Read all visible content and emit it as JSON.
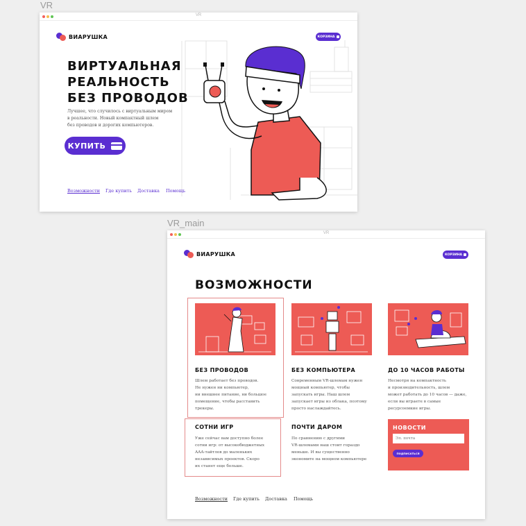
{
  "frames": {
    "vr": {
      "label": "VR",
      "title": "VR"
    },
    "vr_main": {
      "label": "VR_main",
      "title": "VR"
    }
  },
  "window_controls": {
    "close": "#f2605b",
    "minimize": "#f5be4f",
    "maximize": "#61c554"
  },
  "brand": {
    "name": "ВИАРУШКА",
    "accent": "#5a2ed1",
    "coral": "#ed5b55"
  },
  "cart": {
    "label": "КОРЗИНА"
  },
  "hero": {
    "title_lines": [
      "ВИРТУАЛЬНАЯ",
      "РЕАЛЬНОСТЬ",
      "БЕЗ ПРОВОДОВ"
    ],
    "lead_lines": [
      "Лучшее, что случилось с виртуальным миром",
      "в реальности. Новый компактный шлем",
      "без проводов и дорогих компьютеров."
    ],
    "buy_label": "КУПИТЬ"
  },
  "nav_vr": [
    "Возможности",
    "Где купить",
    "Доставка",
    "Помощь"
  ],
  "nav_main": [
    "Возможности",
    "Где купить",
    "Доставка",
    "Помощь"
  ],
  "features": {
    "title": "ВОЗМОЖНОСТИ",
    "items": [
      {
        "heading": "БЕЗ ПРОВОДОВ",
        "lines": [
          "Шлем работает без проводов.",
          "Не нужен ни компьютер,",
          "ни внешнее питание, ни большое",
          "помещение, чтобы расставить",
          "трекеры."
        ]
      },
      {
        "heading": "БЕЗ КОМПЬЮТЕРА",
        "lines": [
          "Современным VR-шлемам нужен",
          "мощный компьютер, чтобы",
          "запускать игры. Наш шлем",
          "запускает игры из облака, поэтому",
          "просто наслаждайтесь."
        ]
      },
      {
        "heading": "ДО 10 ЧАСОВ РАБОТЫ",
        "lines": [
          "Несмотря на компактность",
          "и производительность, шлем",
          "может работать до 10 часов — даже,",
          "если вы играете в самые",
          "ресурсоемкие игры."
        ]
      },
      {
        "heading": "СОТНИ ИГР",
        "lines": [
          "Уже сейчас вам доступно более",
          "сотни игр: от высокобюджетных",
          "AAA-тайтлов до маленьких",
          "независимых проектов. Скоро",
          "их станет еще больше."
        ]
      },
      {
        "heading": "ПОЧТИ ДАРОМ",
        "lines": [
          "По сравнению с другими",
          "VR-шлемами наш стоит гораздо",
          "меньше. И вы существенно",
          "экономите на мощном компьютере"
        ]
      }
    ]
  },
  "newsletter": {
    "title": "НОВОСТИ",
    "placeholder": "Эл. почта",
    "button": "ПОДПИСАТЬСЯ"
  }
}
